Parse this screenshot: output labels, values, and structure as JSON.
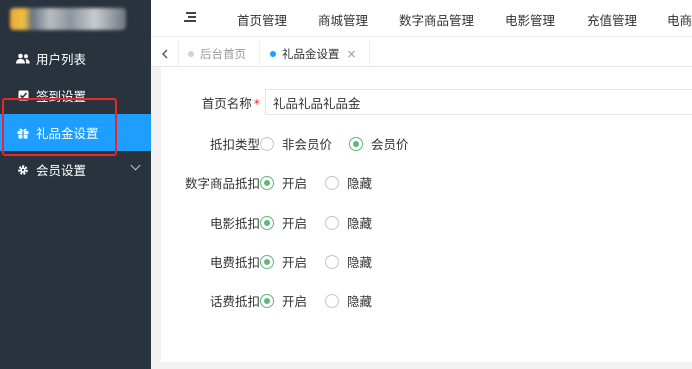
{
  "sidebar": {
    "items": [
      {
        "icon": "users-icon",
        "label": "用户列表"
      },
      {
        "icon": "checkbox-icon",
        "label": "签到设置"
      },
      {
        "icon": "gift-icon",
        "label": "礼品金设置"
      },
      {
        "icon": "gear-icon",
        "label": "会员设置"
      }
    ],
    "active_index": 2
  },
  "topbar": {
    "nav": [
      "首页管理",
      "商城管理",
      "数字商品管理",
      "电影管理",
      "充值管理",
      "电商"
    ]
  },
  "tabs": {
    "items": [
      {
        "label": "后台首页",
        "active": false
      },
      {
        "label": "礼品金设置",
        "active": true,
        "close": "×"
      }
    ]
  },
  "form": {
    "name_field": {
      "label": "首页名称",
      "required_mark": "*",
      "value": "礼品礼品礼品金"
    },
    "radio_rows": [
      {
        "label": "抵扣类型",
        "options": [
          "非会员价",
          "会员价"
        ],
        "selected": 1
      },
      {
        "label": "数字商品抵扣",
        "options": [
          "开启",
          "隐藏"
        ],
        "selected": 0
      },
      {
        "label": "电影抵扣",
        "options": [
          "开启",
          "隐藏"
        ],
        "selected": 0
      },
      {
        "label": "电费抵扣",
        "options": [
          "开启",
          "隐藏"
        ],
        "selected": 0
      },
      {
        "label": "话费抵扣",
        "options": [
          "开启",
          "隐藏"
        ],
        "selected": 0
      }
    ]
  },
  "colors": {
    "sidebar_bg": "#28333e",
    "active_blue": "#1e9fff",
    "radio_green": "#5fb878",
    "annotation_red": "#e8262b"
  }
}
